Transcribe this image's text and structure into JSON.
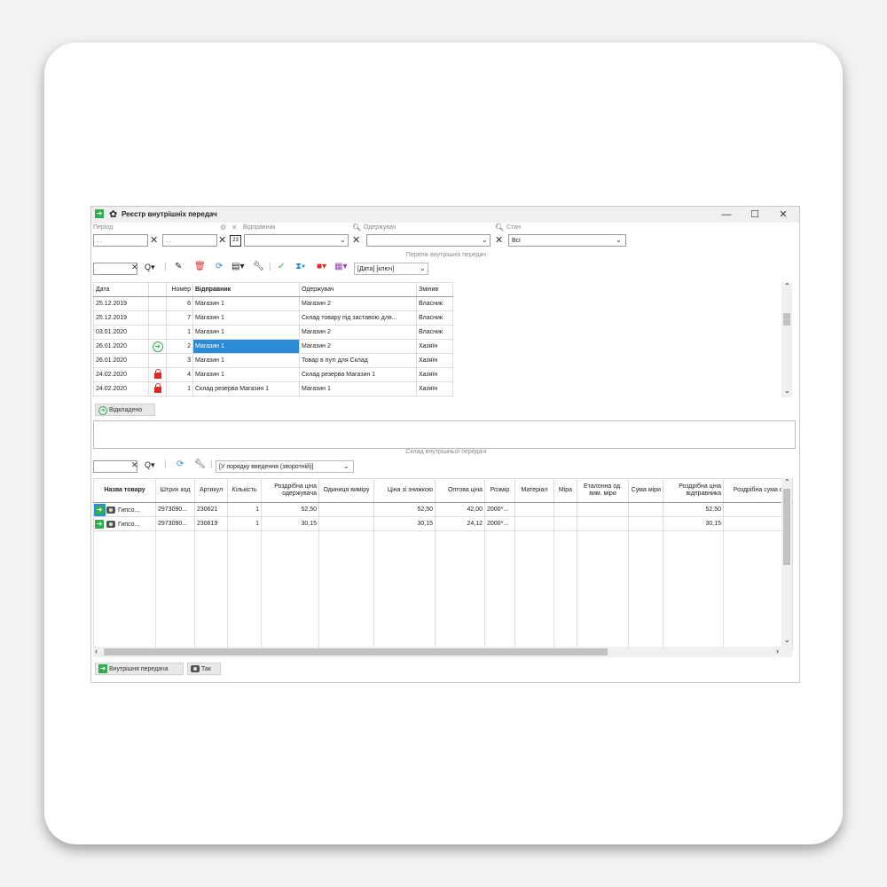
{
  "window": {
    "title": "Реєстр внутрішніх передач",
    "minimize": "—",
    "maximize": "☐",
    "close": "✕"
  },
  "filters": {
    "period_label": "Період",
    "period_from": ". .",
    "period_to": ". .",
    "sender_label": "Відправник",
    "recipient_label": "Одержувач",
    "state_label": "Стан",
    "state_value": "Всі"
  },
  "upper_caption": "Перелік внутрішніх передач",
  "toolbar1": {
    "sort_value": "[Дата] [ключ]"
  },
  "list_table": {
    "headers": [
      "Дата",
      "",
      "Номер",
      "Відправник",
      "Одержувач",
      "Змінив"
    ],
    "rows": [
      {
        "date": "25.12.2019",
        "icon": "",
        "number": "6",
        "sender": "Магазин 1",
        "recipient": "Магазин 2",
        "changed": "Власник"
      },
      {
        "date": "25.12.2019",
        "icon": "",
        "number": "7",
        "sender": "Магазин 1",
        "recipient": "Склад товару під заставою для...",
        "changed": "Власник"
      },
      {
        "date": "03.01.2020",
        "icon": "",
        "number": "1",
        "sender": "Магазин 1",
        "recipient": "Магазин 2",
        "changed": "Власник"
      },
      {
        "date": "26.01.2020",
        "icon": "go",
        "number": "2",
        "sender": "Магазин 1",
        "recipient": "Магазин 2",
        "changed": "Хазяїн"
      },
      {
        "date": "26.01.2020",
        "icon": "",
        "number": "3",
        "sender": "Магазин 1",
        "recipient": "Товар в путі для Склад",
        "changed": "Хазяїн"
      },
      {
        "date": "24.02.2020",
        "icon": "lock",
        "number": "4",
        "sender": "Магазин 1",
        "recipient": "Склад резерва Магазин 1",
        "changed": "Хазяїн"
      },
      {
        "date": "24.02.2020",
        "icon": "lock",
        "number": "1",
        "sender": "Склад резерва Магазин 1",
        "recipient": "Магазин 1",
        "changed": "Хазяїн"
      }
    ]
  },
  "sent_button": "Відкладено",
  "lower_caption": "Склад внутрішньої передачі",
  "toolbar2": {
    "sort_value": "[У порядку введення (зворотній)]"
  },
  "items_table": {
    "headers": [
      "Назва товару",
      "Штрих код",
      "Артикул",
      "Кількість",
      "Роздрібна ціна одержувача",
      "Одиниця виміру",
      "Ціна зі знижкою",
      "Оптова ціна",
      "Розмір",
      "Матеріал",
      "Міра",
      "Еталонна од. вим. міри",
      "Сума міри",
      "Роздрібна ціна відправника",
      "Роздрібна сума с"
    ],
    "rows": [
      {
        "name": "Гипсо...",
        "barcode": "2973090...",
        "article": "230621",
        "qty": "1",
        "retail_recv": "52,50",
        "unit": "",
        "disc_price": "52,50",
        "wholesale": "42,00",
        "size": "2000*...",
        "material": "",
        "measure": "",
        "etalon": "",
        "sum_measure": "",
        "retail_send": "52,50",
        "retail_sum": ""
      },
      {
        "name": "Гипсо...",
        "barcode": "2973090...",
        "article": "230619",
        "qty": "1",
        "retail_recv": "30,15",
        "unit": "",
        "disc_price": "30,15",
        "wholesale": "24,12",
        "size": "2000*...",
        "material": "",
        "measure": "",
        "etalon": "",
        "sum_measure": "",
        "retail_send": "30,15",
        "retail_sum": ""
      }
    ]
  },
  "bottom_tabs": {
    "transfer": "Внутрішня передача",
    "so": "Так"
  },
  "colors": {
    "accent": "#2eae4f",
    "selection": "#2b8bd8",
    "lock": "#e02626"
  }
}
